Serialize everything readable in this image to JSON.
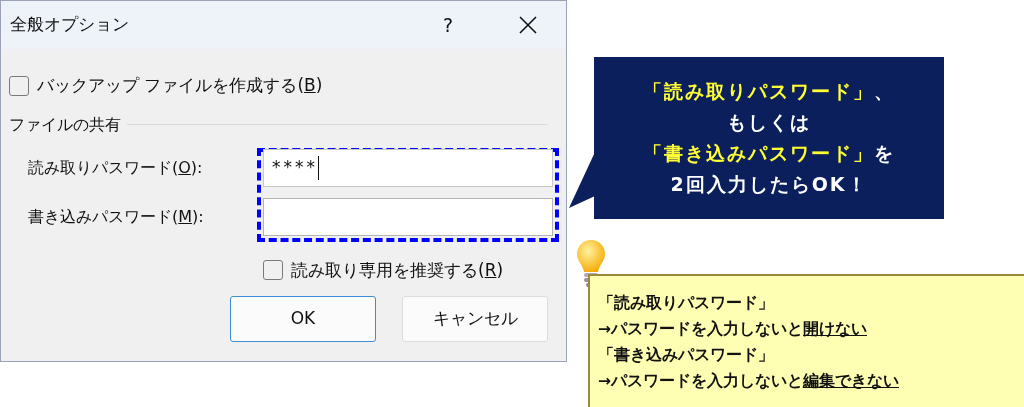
{
  "dialog": {
    "title": "全般オプション",
    "help": "?",
    "backup": {
      "label_parts": [
        "バックアップ ファイルを作成する(",
        "B",
        ")"
      ],
      "checked": false
    },
    "sharing": {
      "heading": "ファイルの共有",
      "fields": [
        {
          "label_parts": [
            "読み取りパスワード(",
            "O",
            "):"
          ],
          "value": "****",
          "focused": true
        },
        {
          "label_parts": [
            "書き込みパスワード(",
            "M",
            "):"
          ],
          "focused": false
        }
      ],
      "readonly": {
        "label_parts": [
          "読み取り専用を推奨する(",
          "R",
          ")"
        ],
        "checked": false
      }
    },
    "buttons": [
      {
        "label": "OK",
        "default": true
      },
      {
        "label": "キャンセル",
        "default": false
      }
    ]
  },
  "callout": {
    "lines": [
      [
        {
          "text": "「読み取りパスワード」",
          "highlight": true
        },
        {
          "text": "、",
          "highlight": false
        }
      ],
      [
        {
          "text": "もしくは",
          "highlight": false
        }
      ],
      [
        {
          "text": "「書き込みパスワード」",
          "highlight": true
        },
        {
          "text": "を",
          "highlight": false
        }
      ],
      [
        {
          "text": "2回入力したらOK！",
          "highlight": false
        }
      ]
    ]
  },
  "note": {
    "lines": [
      [
        {
          "text": "「読み取りパスワード」",
          "emphasis": false
        }
      ],
      [
        {
          "text": "→パスワードを入力しないと",
          "emphasis": false
        },
        {
          "text": "開けない",
          "emphasis": true
        }
      ],
      [
        {
          "text": "「書き込みパスワード」",
          "emphasis": false
        }
      ],
      [
        {
          "text": "→パスワードを入力しないと",
          "emphasis": false
        },
        {
          "text": "編集できない",
          "emphasis": true
        }
      ]
    ]
  }
}
